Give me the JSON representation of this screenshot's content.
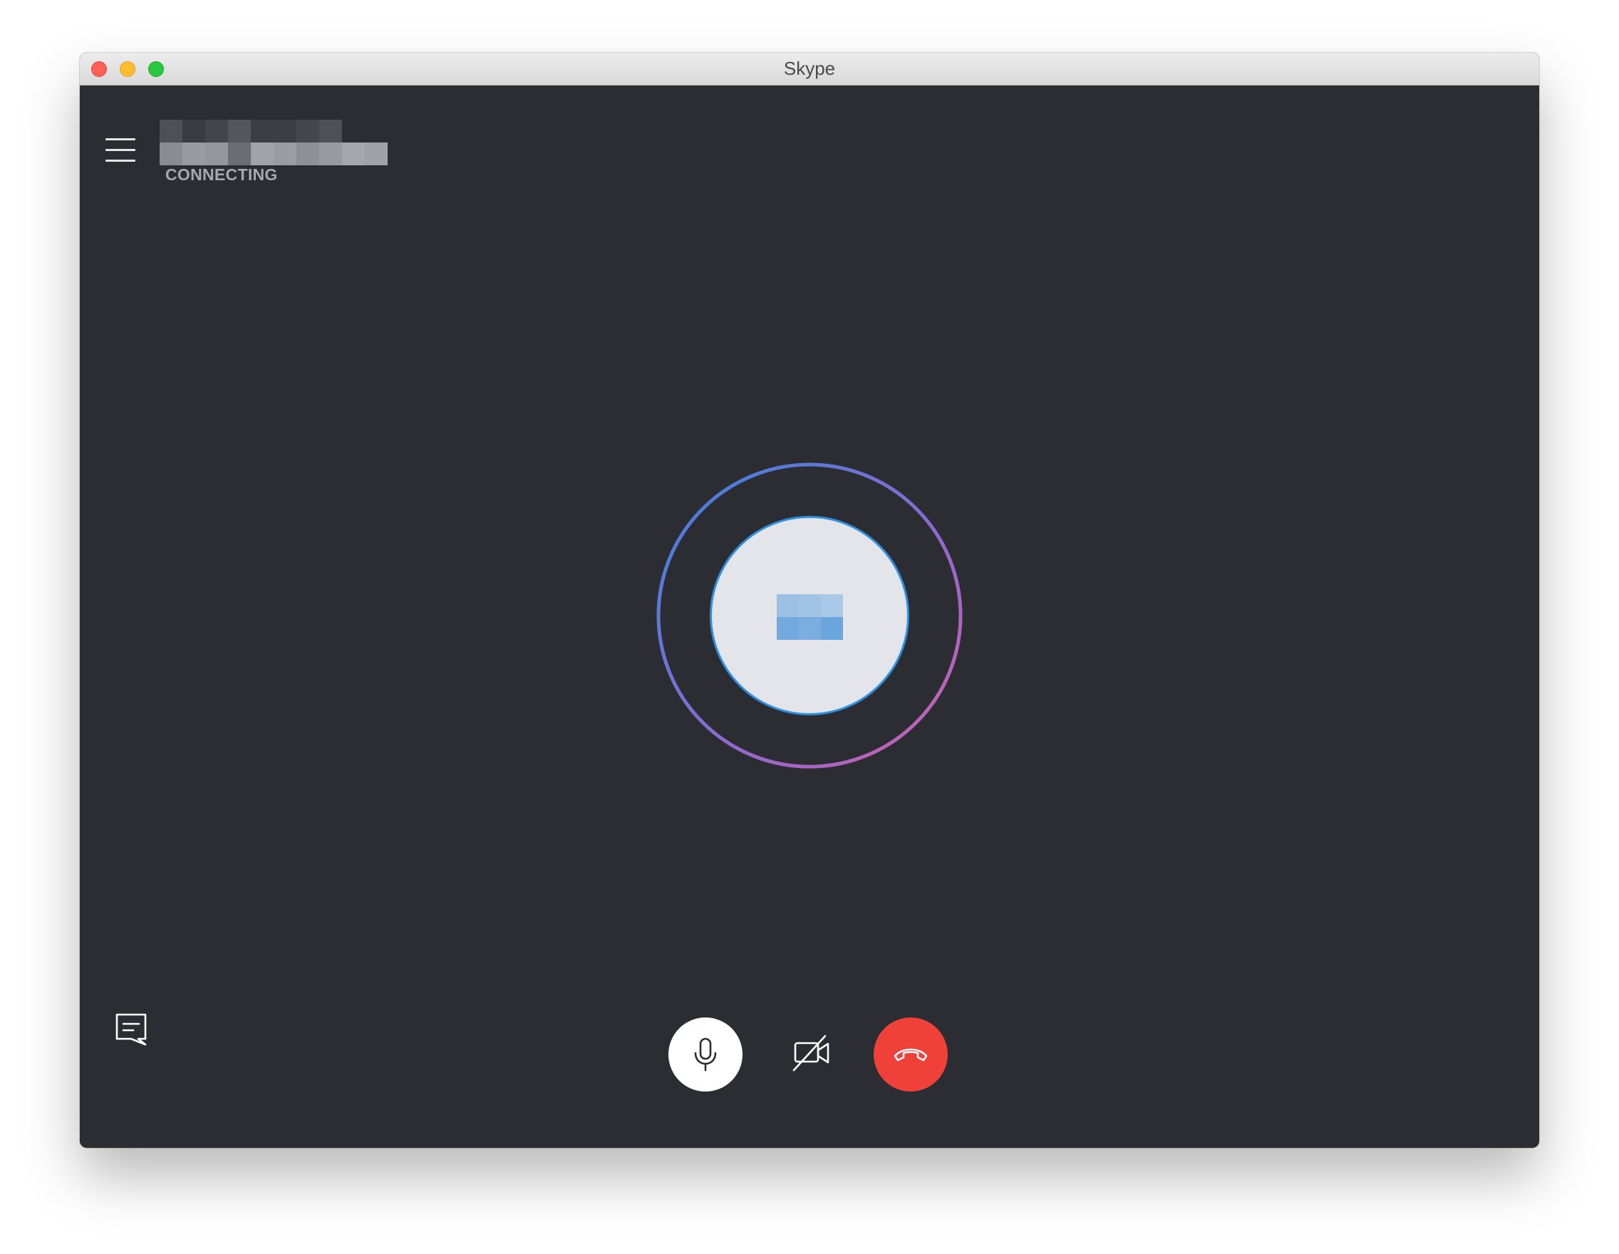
{
  "window": {
    "title": "Skype"
  },
  "call": {
    "status": "CONNECTING",
    "contact_name_redacted": true,
    "avatar_initials_redacted": true
  },
  "controls": {
    "menu_icon": "hamburger-menu-icon",
    "chat_icon": "chat-bubble-icon",
    "mic_icon": "microphone-icon",
    "video_icon": "video-off-icon",
    "end_call_icon": "hang-up-icon"
  },
  "colors": {
    "background": "#2c2d33",
    "status_text": "#a7a8ae",
    "avatar_fill": "#e4e5ea",
    "avatar_border": "#2d8fe0",
    "ring_start": "#3d7fd9",
    "ring_end": "#c563b0",
    "end_call": "#f0403a",
    "mic_button": "#ffffff"
  }
}
